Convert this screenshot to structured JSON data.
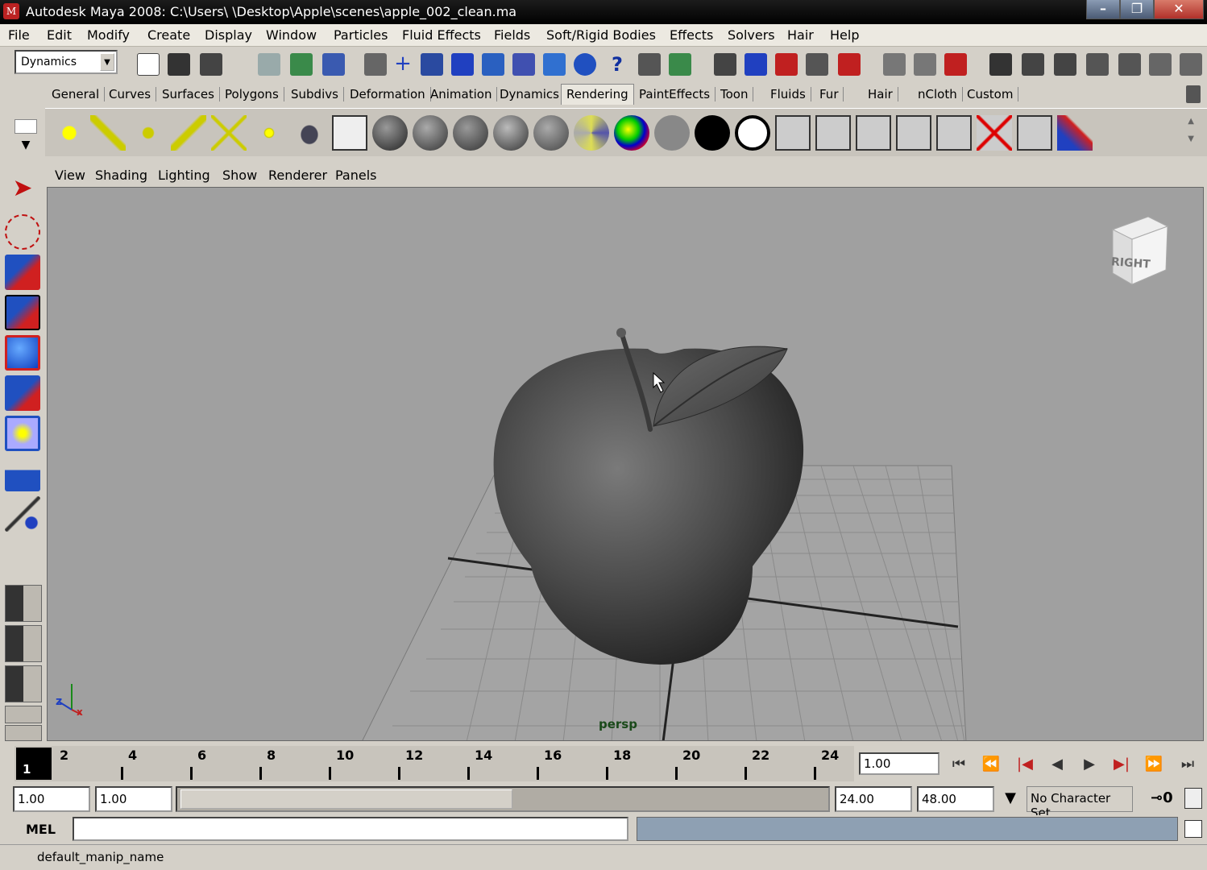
{
  "window": {
    "title": "Autodesk Maya 2008: C:\\Users\\                  \\Desktop\\Apple\\scenes\\apple_002_clean.ma",
    "app_icon": "maya-icon"
  },
  "menubar": [
    "File",
    "Edit",
    "Modify",
    "Create",
    "Display",
    "Window",
    "Particles",
    "Fluid Effects",
    "Fields",
    "Soft/Rigid Bodies",
    "Effects",
    "Solvers",
    "Hair",
    "Help"
  ],
  "status_line": {
    "menu_set": "Dynamics"
  },
  "shelf_tabs": [
    "General",
    "Curves",
    "Surfaces",
    "Polygons",
    "Subdivs",
    "Deformation",
    "Animation",
    "Dynamics",
    "Rendering",
    "PaintEffects",
    "Toon",
    "Fluids",
    "Fur",
    "Hair",
    "nCloth",
    "Custom"
  ],
  "active_shelf_tab": "Rendering",
  "panel_menu": [
    "View",
    "Shading",
    "Lighting",
    "Show",
    "Renderer",
    "Panels"
  ],
  "viewport": {
    "camera_label": "persp",
    "view_cube_label": "RIGHT",
    "axis_labels": {
      "z": "z",
      "x": "x"
    }
  },
  "time_slider": {
    "current_frame_display": "1",
    "tick_labels": [
      "2",
      "4",
      "6",
      "8",
      "10",
      "12",
      "14",
      "16",
      "18",
      "20",
      "22",
      "24"
    ],
    "current_time": "1.00"
  },
  "range_slider": {
    "start_time": "1.00",
    "playback_start": "1.00",
    "playback_end": "24.00",
    "end_time": "48.00",
    "character_set": "No Character Set"
  },
  "command_line": {
    "label": "MEL"
  },
  "help_line": {
    "text": "default_manip_name"
  },
  "colors": {
    "viewport_bg": "#a0a0a0",
    "title_bar": "#000000",
    "ui_bg": "#d4d0c8",
    "command_result_bg": "#8ea0b3"
  }
}
